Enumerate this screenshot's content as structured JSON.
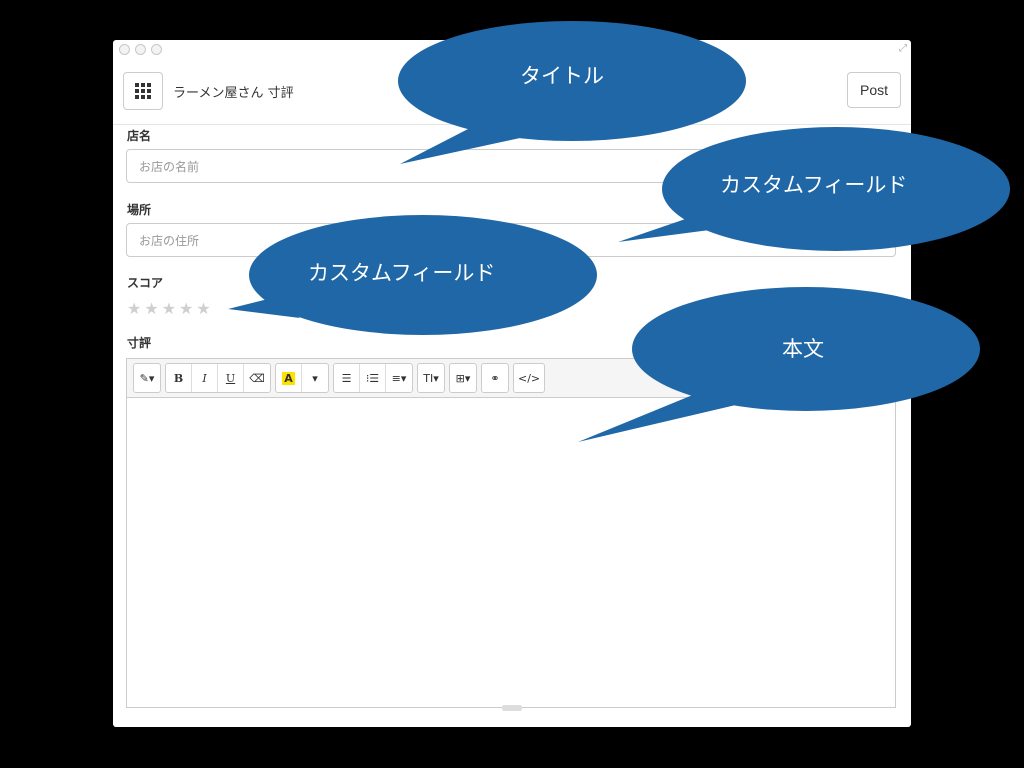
{
  "window": {
    "title_value": "ラーメン屋さん 寸評",
    "post_label": "Post"
  },
  "fields": {
    "shop_name_label": "店名",
    "shop_name_placeholder": "お店の名前",
    "place_label": "場所",
    "place_placeholder": "お店の住所",
    "score_label": "スコア",
    "score_value": 0,
    "score_max": 5,
    "review_label": "寸評"
  },
  "toolbar": {
    "style": "✎▾",
    "bold": "B",
    "italic": "I",
    "underline": "U",
    "eraser": "⌫",
    "font_color": "A",
    "color_dropdown": "▾",
    "unordered_list": "☰",
    "ordered_list": "⁝☰",
    "paragraph": "≡▾",
    "font_size": "TI▾",
    "table": "⊞▾",
    "link": "⚭",
    "code": "</>"
  },
  "callouts": {
    "title": "タイトル",
    "custom_field_1": "カスタムフィールド",
    "custom_field_2": "カスタムフィールド",
    "body": "本文"
  },
  "colors": {
    "callout_fill": "#1f67a6",
    "highlight": "#ffe100"
  }
}
